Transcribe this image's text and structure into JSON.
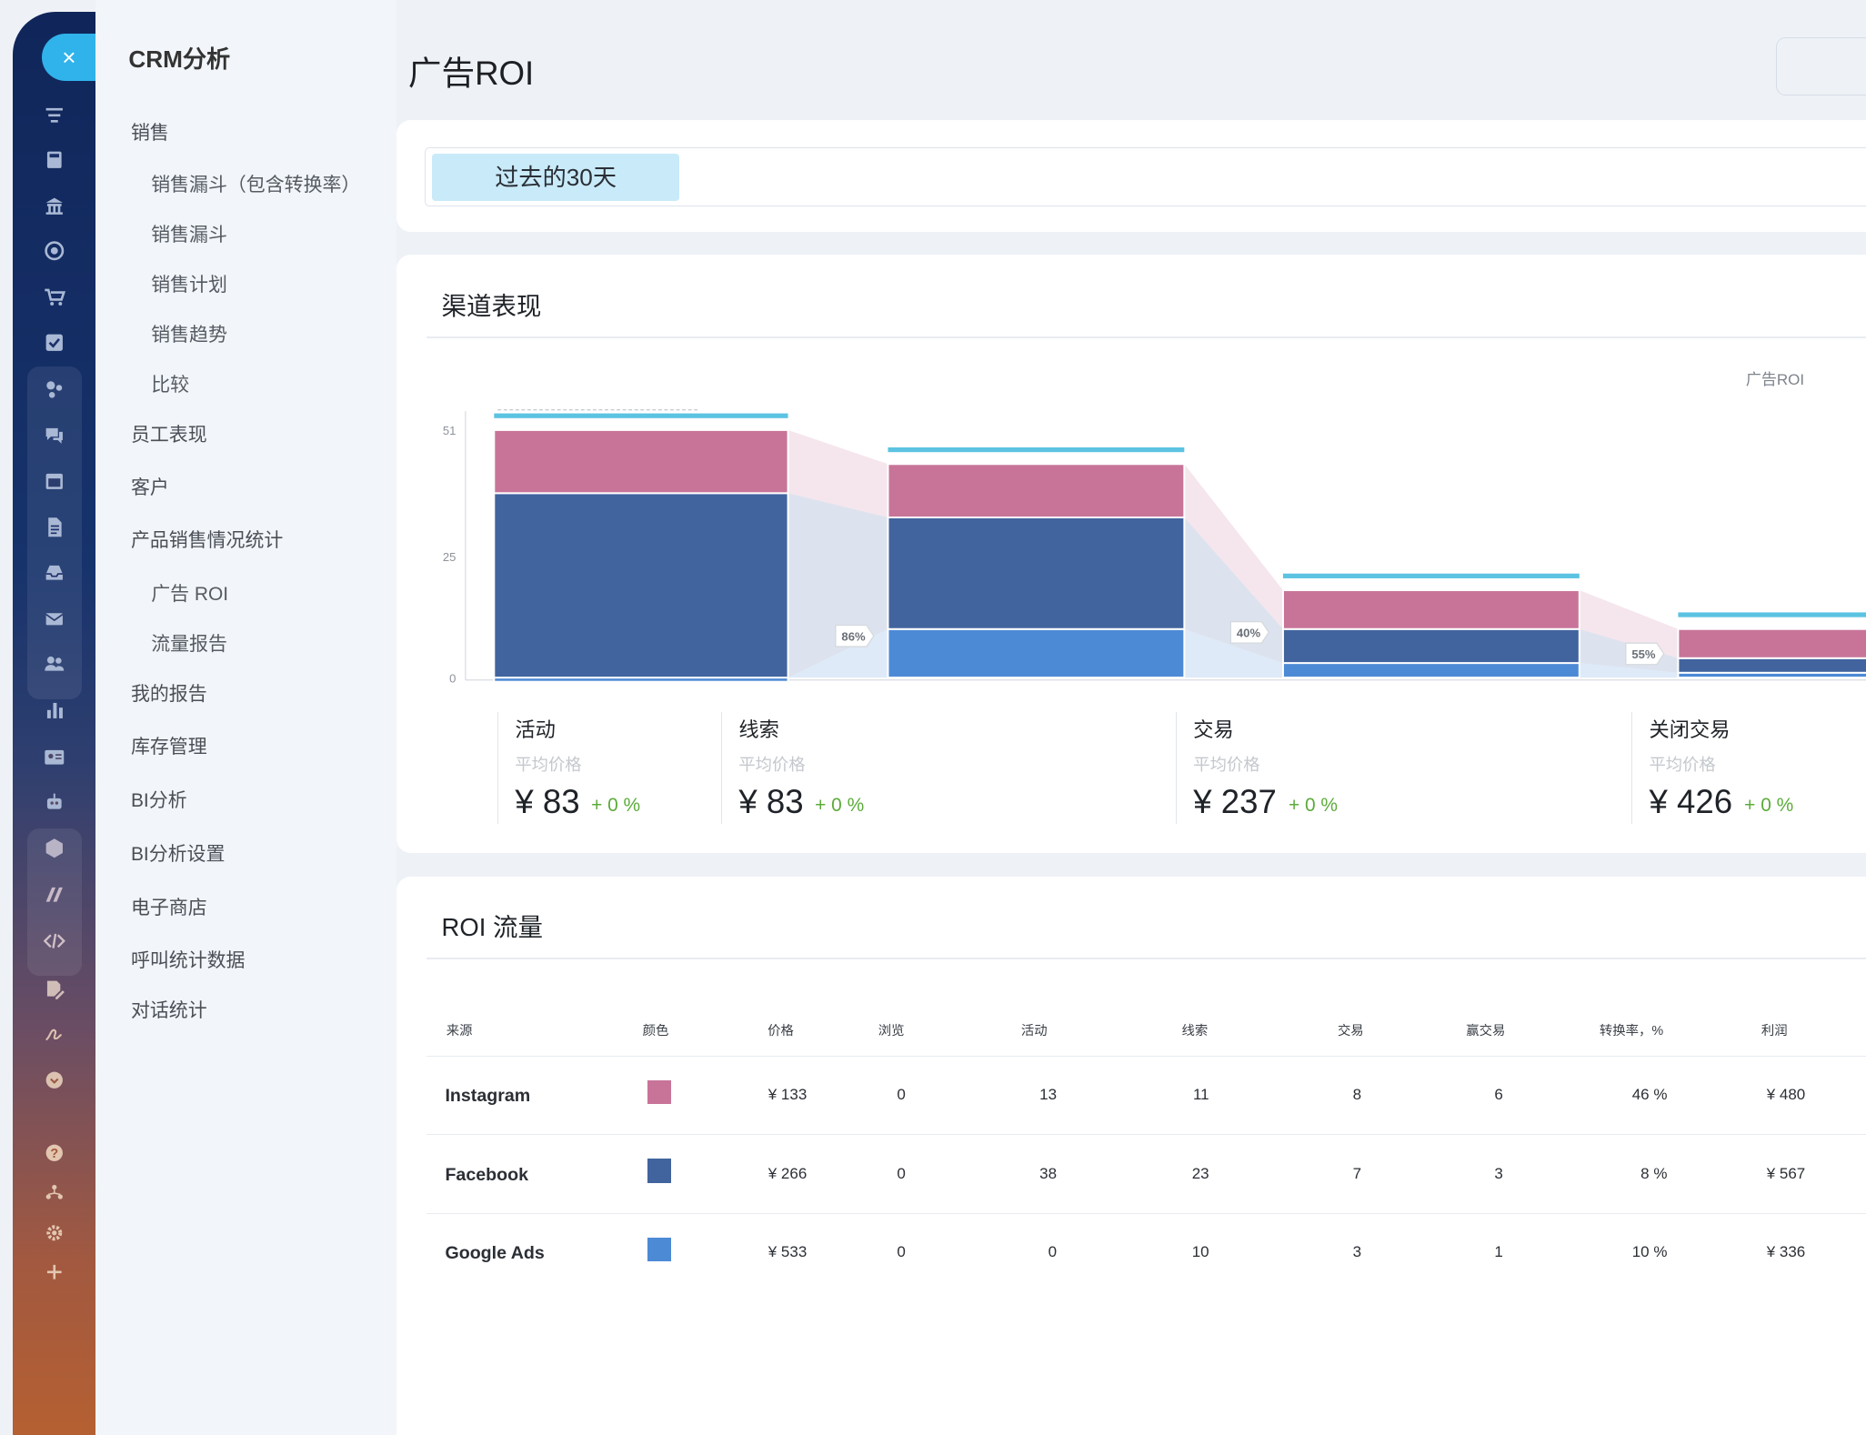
{
  "app": {
    "rail_icons": [
      {
        "name": "funnel-icon"
      },
      {
        "name": "calculator-icon"
      },
      {
        "name": "bank-icon"
      },
      {
        "name": "target-icon"
      },
      {
        "name": "cart-icon"
      },
      {
        "name": "checkbox-icon"
      },
      {
        "name": "analytics-icon"
      },
      {
        "name": "chat-icon"
      },
      {
        "name": "calendar-icon"
      },
      {
        "name": "document-icon"
      },
      {
        "name": "inbox-icon"
      },
      {
        "name": "mail-icon"
      },
      {
        "name": "users-icon"
      },
      {
        "name": "bar-chart-icon"
      },
      {
        "name": "id-card-icon"
      },
      {
        "name": "robot-icon"
      },
      {
        "name": "box-icon"
      },
      {
        "name": "brand-icon"
      },
      {
        "name": "code-icon"
      },
      {
        "name": "edit-doc-icon"
      },
      {
        "name": "signature-icon"
      },
      {
        "name": "chevron-circle-icon"
      },
      {
        "name": "help-icon"
      },
      {
        "name": "sitemap-icon"
      },
      {
        "name": "settings-icon"
      },
      {
        "name": "plus-icon"
      }
    ],
    "close_symbol": "×"
  },
  "menu": {
    "title": "CRM分析",
    "items": [
      {
        "label": "销售",
        "sub": false
      },
      {
        "label": "销售漏斗（包含转换率）",
        "sub": true
      },
      {
        "label": "销售漏斗",
        "sub": true
      },
      {
        "label": "销售计划",
        "sub": true
      },
      {
        "label": "销售趋势",
        "sub": true
      },
      {
        "label": "比较",
        "sub": true
      },
      {
        "label": "员工表现",
        "sub": false
      },
      {
        "label": "客户",
        "sub": false
      },
      {
        "label": "产品销售情况统计",
        "sub": false
      },
      {
        "label": "广告 ROI",
        "sub": true
      },
      {
        "label": "流量报告",
        "sub": true
      },
      {
        "label": "我的报告",
        "sub": false
      },
      {
        "label": "库存管理",
        "sub": false
      },
      {
        "label": "BI分析",
        "sub": false
      },
      {
        "label": "BI分析设置",
        "sub": false
      },
      {
        "label": "电子商店",
        "sub": false
      },
      {
        "label": "呼叫统计数据",
        "sub": false
      },
      {
        "label": "对话统计",
        "sub": false
      }
    ]
  },
  "page": {
    "title": "广告ROI",
    "filter_chip": "过去的30天"
  },
  "channel": {
    "title": "渠道表现",
    "stats": [
      {
        "name": "活动",
        "sub": "平均价格",
        "value": "¥ 83",
        "change": "+ 0 %"
      },
      {
        "name": "线索",
        "sub": "平均价格",
        "value": "¥ 83",
        "change": "+ 0 %"
      },
      {
        "name": "交易",
        "sub": "平均价格",
        "value": "¥ 237",
        "change": "+ 0 %"
      },
      {
        "name": "关闭交易",
        "sub": "平均价格",
        "value": "¥ 426",
        "change": "+ 0 %"
      }
    ]
  },
  "chart_data": {
    "type": "bar",
    "stacked": true,
    "legend_label": "广告ROI",
    "y_ticks": [
      "0",
      "25",
      "51"
    ],
    "ylim": [
      0,
      51
    ],
    "categories": [
      "活动",
      "线索",
      "交易",
      "关闭交易"
    ],
    "conversion_labels": [
      "86%",
      "40%",
      "55%"
    ],
    "colors": {
      "Instagram": "#c87499",
      "Facebook": "#42649e",
      "Google Ads": "#4d8ad6",
      "top_band": "#5cc3e2"
    },
    "series": [
      {
        "name": "Google Ads",
        "values": [
          0,
          10,
          3,
          1
        ]
      },
      {
        "name": "Facebook",
        "values": [
          38,
          23,
          7,
          3
        ]
      },
      {
        "name": "Instagram",
        "values": [
          13,
          11,
          8,
          6
        ]
      }
    ]
  },
  "roi": {
    "title": "ROI 流量",
    "columns": [
      "来源",
      "颜色",
      "价格",
      "浏览",
      "活动",
      "线索",
      "交易",
      "赢交易",
      "转换率，%",
      "利润"
    ],
    "rows": [
      {
        "source": "Instagram",
        "color": "#c87499",
        "price": "¥ 133",
        "views": "0",
        "activities": "13",
        "leads": "11",
        "deals": "8",
        "won": "6",
        "conv": "46 %",
        "profit": "¥ 480"
      },
      {
        "source": "Facebook",
        "color": "#42649e",
        "price": "¥ 266",
        "views": "0",
        "activities": "38",
        "leads": "23",
        "deals": "7",
        "won": "3",
        "conv": "8 %",
        "profit": "¥ 567"
      },
      {
        "source": "Google Ads",
        "color": "#4d8ad6",
        "price": "¥ 533",
        "views": "0",
        "activities": "0",
        "leads": "10",
        "deals": "3",
        "won": "1",
        "conv": "10 %",
        "profit": "¥ 336"
      }
    ]
  }
}
